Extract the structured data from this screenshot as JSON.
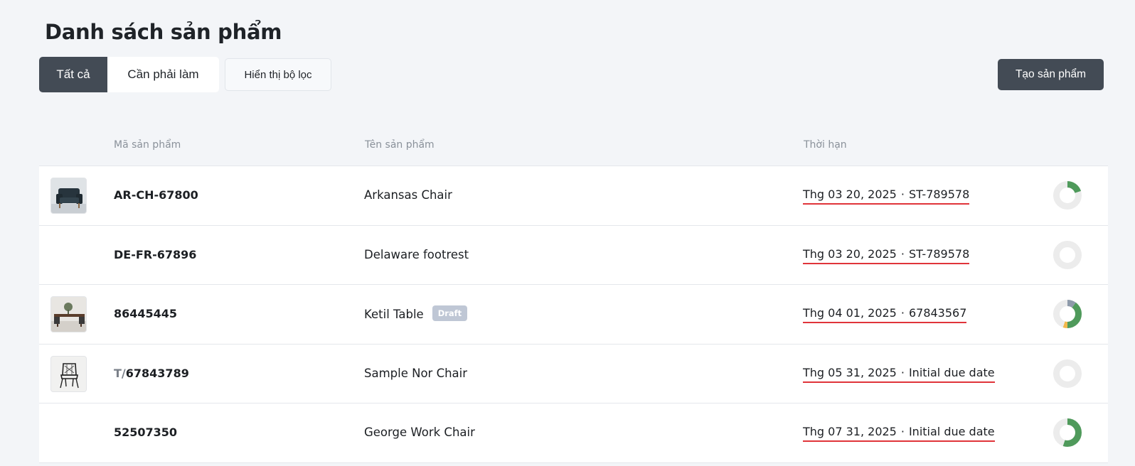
{
  "page": {
    "title": "Danh sách sản phẩm"
  },
  "toolbar": {
    "tabs": [
      {
        "label": "Tất cả",
        "active": true
      },
      {
        "label": "Cần phải làm",
        "active": false
      }
    ],
    "filter_label": "Hiển thị bộ lọc",
    "create_label": "Tạo sản phẩm"
  },
  "table": {
    "headers": {
      "code": "Mã sản phẩm",
      "name": "Tên sản phẩm",
      "due": "Thời hạn"
    },
    "rows": [
      {
        "has_thumb": true,
        "thumb_icon": "armchair-photo",
        "code_prefix": "",
        "code": "AR-CH-67800",
        "name": "Arkansas Chair",
        "badge": "",
        "due_date": "Thg 03 20, 2025",
        "due_sep": "·",
        "due_ref": "ST-789578",
        "progress": [
          {
            "fraction": 0.2,
            "color": "#4f9a5b"
          }
        ]
      },
      {
        "has_thumb": false,
        "code_prefix": "",
        "code": "DE-FR-67896",
        "name": "Delaware footrest",
        "badge": "",
        "due_date": "Thg 03 20, 2025",
        "due_sep": "·",
        "due_ref": "ST-789578",
        "progress": []
      },
      {
        "has_thumb": true,
        "thumb_icon": "table-photo",
        "code_prefix": "",
        "code": "86445445",
        "name": "Ketil Table",
        "badge": "Draft",
        "due_date": "Thg 04 01, 2025",
        "due_sep": "·",
        "due_ref": "67843567",
        "progress": [
          {
            "fraction": 0.1,
            "color": "#8e9aaa"
          },
          {
            "fraction": 0.4,
            "color": "#4f9a5b"
          },
          {
            "fraction": 0.05,
            "color": "#f2b84b"
          }
        ]
      },
      {
        "has_thumb": true,
        "thumb_icon": "sketch-chair-photo",
        "code_prefix": "T/",
        "code": "67843789",
        "name": "Sample Nor Chair",
        "badge": "",
        "due_date": "Thg 05 31, 2025",
        "due_sep": "·",
        "due_ref": "Initial due date",
        "progress": []
      },
      {
        "has_thumb": false,
        "code_prefix": "",
        "code": "52507350",
        "name": "George Work Chair",
        "badge": "",
        "due_date": "Thg 07 31, 2025",
        "due_sep": "·",
        "due_ref": "Initial due date",
        "progress": [
          {
            "fraction": 0.55,
            "color": "#4f9a5b"
          }
        ]
      }
    ]
  },
  "colors": {
    "accent_dark": "#434b55",
    "due_underline": "#e0343a",
    "ring_track": "#ececec",
    "draft_badge": "#bfc7d5"
  }
}
